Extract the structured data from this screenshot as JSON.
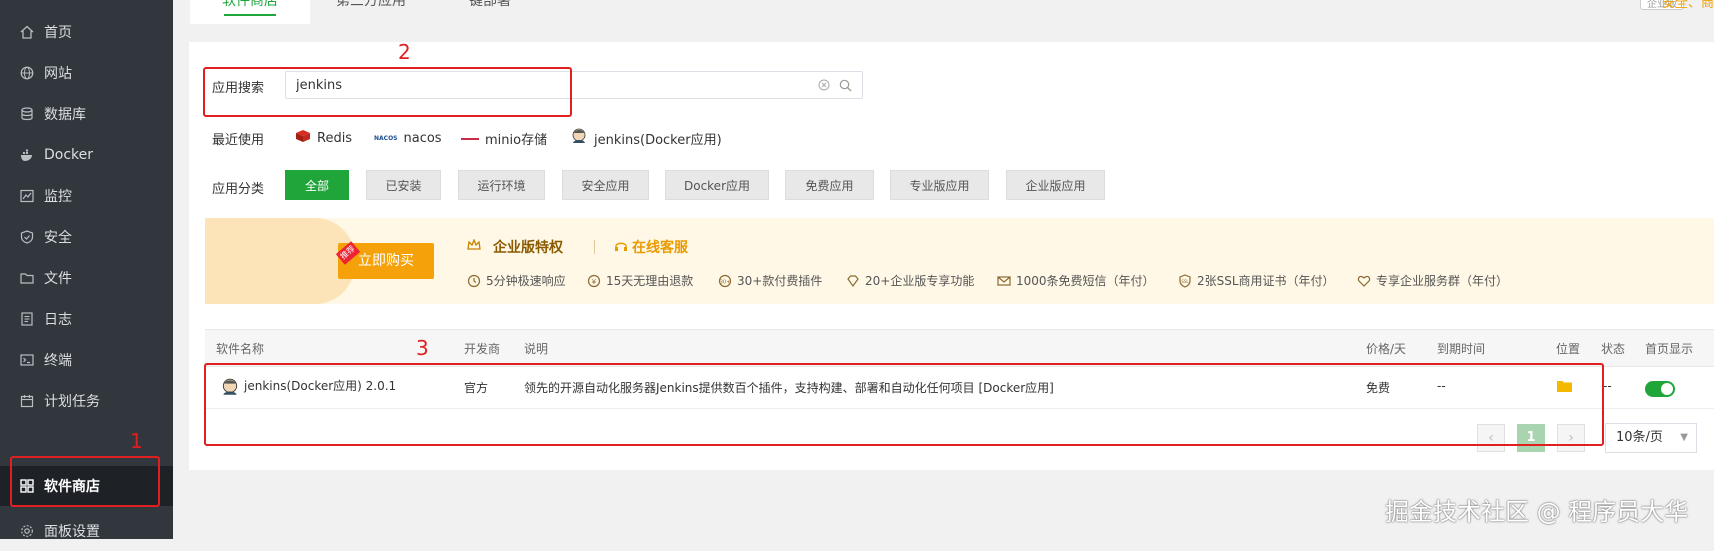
{
  "sidebar": {
    "items": [
      {
        "label": "首页",
        "icon": "home-icon"
      },
      {
        "label": "网站",
        "icon": "globe-icon"
      },
      {
        "label": "数据库",
        "icon": "database-icon"
      },
      {
        "label": "Docker",
        "icon": "docker-icon"
      },
      {
        "label": "监控",
        "icon": "monitor-icon"
      },
      {
        "label": "安全",
        "icon": "shield-icon"
      },
      {
        "label": "文件",
        "icon": "folder-icon"
      },
      {
        "label": "日志",
        "icon": "log-icon"
      },
      {
        "label": "终端",
        "icon": "terminal-icon"
      },
      {
        "label": "计划任务",
        "icon": "calendar-icon"
      },
      {
        "label": "软件商店",
        "icon": "grid-icon",
        "active": true
      },
      {
        "label": "面板设置",
        "icon": "gear-icon"
      }
    ]
  },
  "top_tabs": [
    {
      "label": "软件商店",
      "active": true
    },
    {
      "label": "第三方应用"
    },
    {
      "label": "一键部署"
    }
  ],
  "top_right": {
    "badge": "企业版",
    "text": "安全、商"
  },
  "search": {
    "label": "应用搜索",
    "value": "jenkins"
  },
  "recent": {
    "label": "最近使用",
    "items": [
      "Redis",
      "nacos",
      "minio存储",
      "jenkins(Docker应用)"
    ]
  },
  "categories": {
    "label": "应用分类",
    "items": [
      "全部",
      "已安装",
      "运行环境",
      "安全应用",
      "Docker应用",
      "免费应用",
      "专业版应用",
      "企业版应用"
    ]
  },
  "promo": {
    "buy_label": "立即购买",
    "hot_tag": "推荐",
    "title": "企业版特权",
    "service": "在线客服",
    "features": [
      "5分钟极速响应",
      "15天无理由退款",
      "30+款付费插件",
      "20+企业版专享功能",
      "1000条免费短信（年付）",
      "2张SSL商用证书（年付）",
      "专享企业服务群（年付）"
    ]
  },
  "table": {
    "headers": [
      "软件名称",
      "开发商",
      "说明",
      "价格/天",
      "到期时间",
      "位置",
      "状态",
      "首页显示"
    ],
    "rows": [
      {
        "name": "jenkins(Docker应用) 2.0.1",
        "developer": "官方",
        "description": "领先的开源自动化服务器Jenkins提供数百个插件，支持构建、部署和自动化任何项目 [Docker应用]",
        "price": "免费",
        "expire": "--",
        "status": "--",
        "home_display": true
      }
    ]
  },
  "pagination": {
    "current": "1",
    "page_size": "10条/页",
    "prev": "‹",
    "next": "›"
  },
  "annotations": {
    "n1": "1",
    "n2": "2",
    "n3": "3"
  },
  "watermark": "掘金技术社区 @ 程序员大华",
  "colors": {
    "accent": "#20a53a",
    "annotation": "#e02020",
    "sidebar_bg": "#31373d"
  }
}
